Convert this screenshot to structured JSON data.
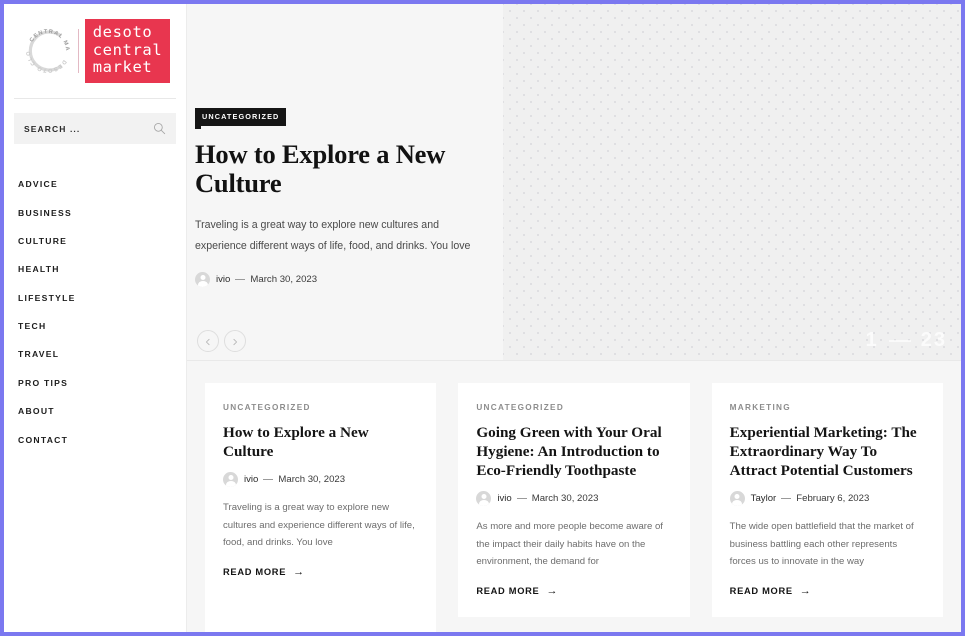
{
  "theme": {
    "browser_border": "#7b78f0",
    "brand_red": "#e8364f",
    "badge_bg": "#151515",
    "page_bg": "#f6f6f6"
  },
  "sidebar": {
    "logo": {
      "stamp_text_top": "CENTRAL MARKET",
      "stamp_text_bottom": "DESOTO CLOSED",
      "name_line1": "desoto",
      "name_line2": "central",
      "name_line3": "market"
    },
    "search": {
      "placeholder": "SEARCH ...",
      "value": "",
      "icon": "search-icon"
    },
    "menu": [
      {
        "label": "ADVICE"
      },
      {
        "label": "BUSINESS"
      },
      {
        "label": "CULTURE"
      },
      {
        "label": "HEALTH"
      },
      {
        "label": "LIFESTYLE"
      },
      {
        "label": "TECH"
      },
      {
        "label": "TRAVEL"
      },
      {
        "label": "PRO TIPS"
      },
      {
        "label": "ABOUT"
      },
      {
        "label": "CONTACT"
      }
    ]
  },
  "hero": {
    "badge": "UNCATEGORIZED",
    "title": "How to Explore a New Culture",
    "excerpt": "Traveling is a great way to explore new cultures and experience different ways of life, food, and drinks. You love",
    "author": "ivio",
    "date": "March 30, 2023",
    "slide_current": "1",
    "slide_total": "23",
    "prev_icon": "chevron-left-icon",
    "next_icon": "chevron-right-icon"
  },
  "cards": [
    {
      "category": "UNCATEGORIZED",
      "title": "How to Explore a New Culture",
      "author": "ivio",
      "date": "March 30, 2023",
      "excerpt": "Traveling is a great way to explore new cultures and experience different ways of life, food, and drinks. You love",
      "read_more": "READ MORE",
      "arrow": "→"
    },
    {
      "category": "UNCATEGORIZED",
      "title": "Going Green with Your Oral Hygiene: An Introduction to Eco-Friendly Toothpaste",
      "author": "ivio",
      "date": "March 30, 2023",
      "excerpt": "As more and more people become aware of the impact their daily habits have on the environment, the demand for",
      "read_more": "READ MORE",
      "arrow": "→"
    },
    {
      "category": "MARKETING",
      "title": "Experiential Marketing: The Extraordinary Way To Attract Potential Customers",
      "author": "Taylor",
      "date": "February 6, 2023",
      "excerpt": "The wide open battlefield that the market of business battling each other represents forces us to innovate in the way",
      "read_more": "READ MORE",
      "arrow": "→"
    }
  ]
}
